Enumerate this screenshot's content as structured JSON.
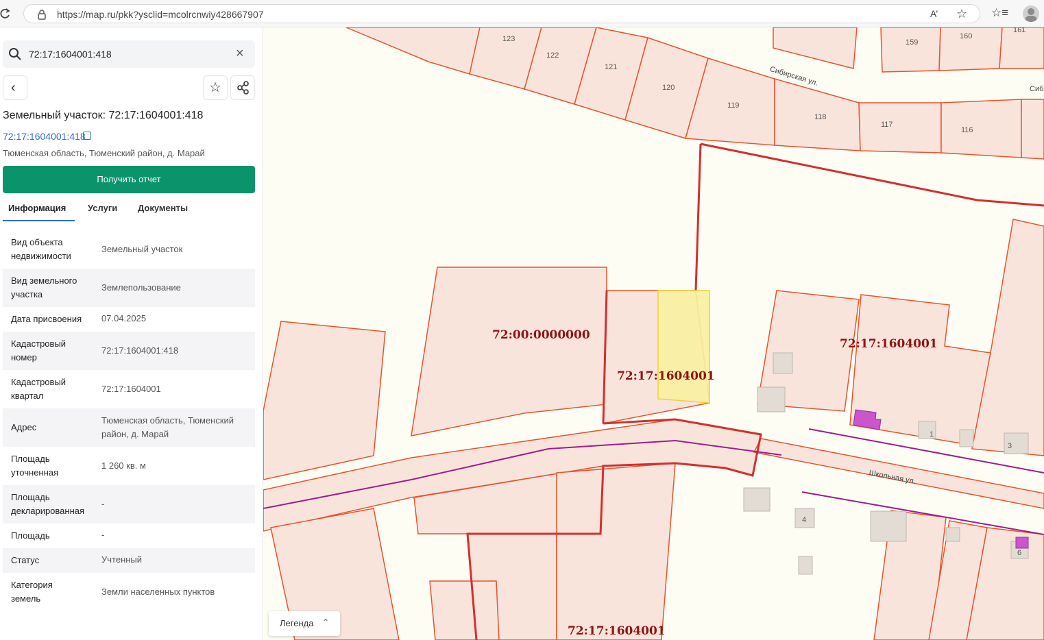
{
  "browser": {
    "url": "https://map.ru/pkk?ysclid=mcolrcnwiy428667907",
    "read_aloud_icon": "A’"
  },
  "search": {
    "value": "72:17:1604001:418"
  },
  "object": {
    "title": "Земельный участок: 72:17:1604001:418",
    "cadastral_link": "72:17:1604001:418",
    "address_line": "Тюменская область, Тюменский район, д. Марай"
  },
  "report_button": "Получить отчет",
  "tabs": [
    "Информация",
    "Услуги",
    "Документы"
  ],
  "info": [
    {
      "label": "Вид объекта недвижимости",
      "value": "Земельный участок"
    },
    {
      "label": "Вид земельного участка",
      "value": "Землепользование"
    },
    {
      "label": "Дата присвоения",
      "value": "07.04.2025"
    },
    {
      "label": "Кадастровый номер",
      "value": "72:17:1604001:418"
    },
    {
      "label": "Кадастровый квартал",
      "value": "72:17:1604001"
    },
    {
      "label": "Адрес",
      "value": "Тюменская область, Тюменский район, д. Марай"
    },
    {
      "label": "Площадь уточненная",
      "value": "1 260 кв. м"
    },
    {
      "label": "Площадь декларированная",
      "value": "-"
    },
    {
      "label": "Площадь",
      "value": "-"
    },
    {
      "label": "Статус",
      "value": "Учтенный"
    },
    {
      "label": "Категория земель",
      "value": "Земли населенных пунктов"
    }
  ],
  "map": {
    "quarter_labels": [
      "72:00:0000000",
      "72:17:1604001",
      "72:17:1604001",
      "72:17:1604001"
    ],
    "lot_numbers": [
      "123",
      "122",
      "121",
      "120",
      "119",
      "118",
      "117",
      "116",
      "159",
      "160",
      "161",
      "1",
      "3",
      "4",
      "6"
    ],
    "streets": [
      "Сибирская ул.",
      "Сиб",
      "Школьная ул."
    ],
    "legend_button": "Легенда",
    "colors": {
      "parcel_fill": "#f9e4dc",
      "parcel_stroke": "#e8532d",
      "quarter_stroke": "#d32f2f",
      "selected_fill": "#f8f0a0",
      "selected_stroke": "#f0d040",
      "utility_line": "#9c1d8e",
      "building": "#cc55cc"
    }
  }
}
